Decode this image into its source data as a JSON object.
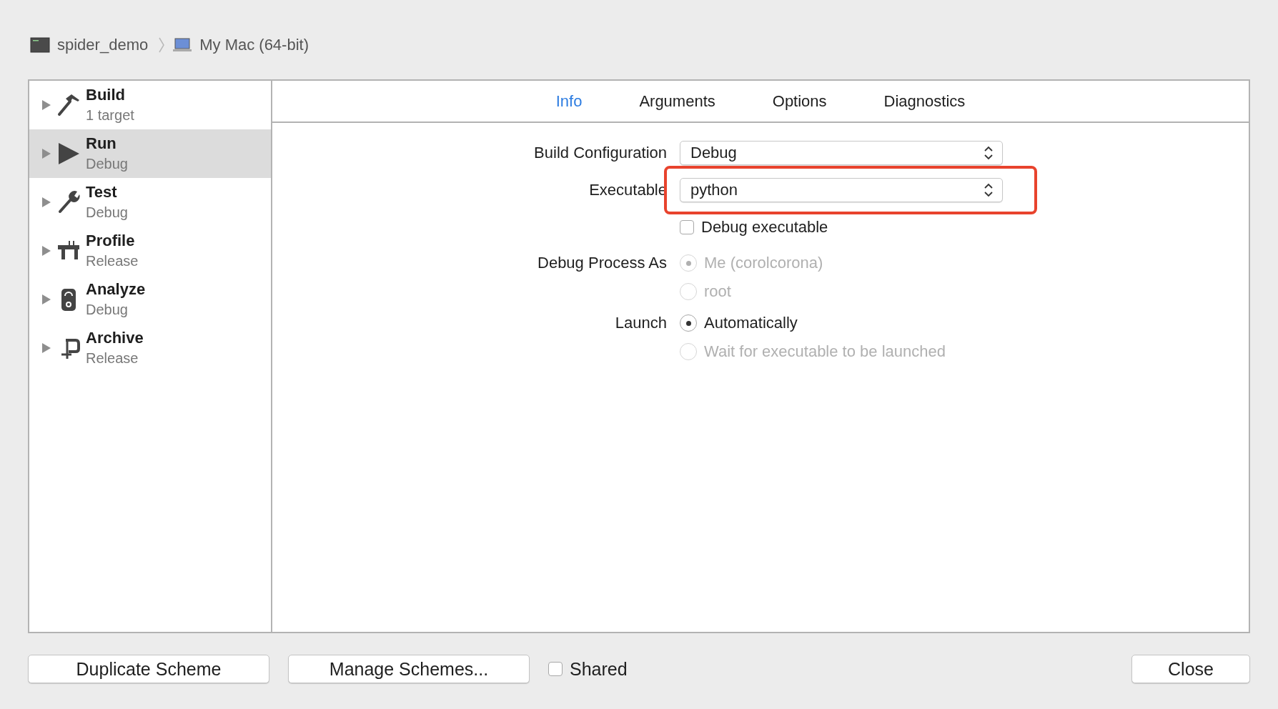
{
  "breadcrumb": [
    {
      "kind": "app",
      "label": "spider_demo"
    },
    {
      "kind": "computer",
      "label": "My Mac (64-bit)"
    }
  ],
  "sidebar": {
    "items": [
      {
        "kind": "build",
        "name": "Build",
        "detail": "1 target",
        "selected": false,
        "expanded": false
      },
      {
        "kind": "run",
        "name": "Run",
        "detail": "Debug",
        "selected": true,
        "expanded": false
      },
      {
        "kind": "test",
        "name": "Test",
        "detail": "Debug",
        "selected": false,
        "expanded": false
      },
      {
        "kind": "profile",
        "name": "Profile",
        "detail": "Release",
        "selected": false,
        "expanded": false
      },
      {
        "kind": "analyze",
        "name": "Analyze",
        "detail": "Debug",
        "selected": false,
        "expanded": false
      },
      {
        "kind": "archive",
        "name": "Archive",
        "detail": "Release",
        "selected": false,
        "expanded": false
      }
    ]
  },
  "tabs": [
    {
      "label": "Info",
      "selected": true
    },
    {
      "label": "Arguments",
      "selected": false
    },
    {
      "label": "Options",
      "selected": false
    },
    {
      "label": "Diagnostics",
      "selected": false
    }
  ],
  "form": {
    "build_configuration": {
      "label": "Build Configuration",
      "value": "Debug",
      "highlighted": false
    },
    "executable": {
      "label": "Executable",
      "value": "python",
      "highlighted": true
    },
    "debug_executable": {
      "label": "Debug executable",
      "checked": false
    },
    "debug_process_as": {
      "label": "Debug Process As",
      "options": [
        {
          "label": "Me (corolcorona)",
          "selected": true,
          "disabled": true
        },
        {
          "label": "root",
          "selected": false,
          "disabled": true
        }
      ]
    },
    "launch": {
      "label": "Launch",
      "options": [
        {
          "label": "Automatically",
          "selected": true,
          "disabled": false
        },
        {
          "label": "Wait for executable to be launched",
          "selected": false,
          "disabled": true
        }
      ]
    }
  },
  "footer": {
    "duplicate_button": "Duplicate Scheme",
    "manage_button": "Manage Schemes...",
    "shared": {
      "label": "Shared",
      "checked": false
    },
    "close_button": "Close"
  }
}
